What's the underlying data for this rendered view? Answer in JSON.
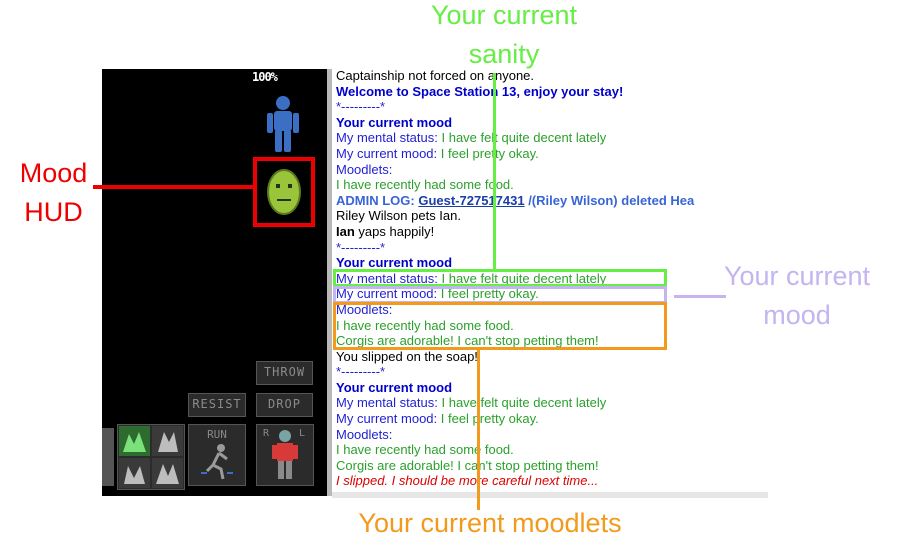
{
  "hud": {
    "health_percent": "100%",
    "buttons": {
      "throw": "THROW",
      "resist": "RESIST",
      "drop": "DROP",
      "run": "RUN",
      "r": "R",
      "l": "L"
    }
  },
  "chat": {
    "lines": [
      {
        "text": "Captainship not forced on anyone."
      },
      {
        "text": "Welcome to Space Station 13, enjoy your stay!"
      },
      {
        "text": "*---------*"
      },
      {
        "text": "Your current mood"
      },
      {
        "label": "My mental status: ",
        "value": "I have felt quite decent lately"
      },
      {
        "label": "My current mood: ",
        "value": "I feel pretty okay."
      },
      {
        "text": "Moodlets:"
      },
      {
        "text": "I have recently had some food."
      },
      {
        "prefix": "ADMIN LOG: ",
        "link": "Guest-727517431",
        "rest": " /(Riley Wilson) deleted Hea"
      },
      {
        "text": "Riley Wilson pets Ian."
      },
      {
        "name": "Ian",
        "rest": " yaps happily!"
      },
      {
        "text": "*---------*"
      },
      {
        "text": "Your current mood"
      },
      {
        "label": "My mental status: ",
        "value": "I have felt quite decent lately"
      },
      {
        "label": "My current mood: ",
        "value": "I feel pretty okay."
      },
      {
        "text": "Moodlets:"
      },
      {
        "text": "I have recently had some food."
      },
      {
        "text": "Corgis are adorable! I can't stop petting them!"
      },
      {
        "text": "You slipped on the soap!"
      },
      {
        "text": "*---------*"
      },
      {
        "text": "Your current mood"
      },
      {
        "label": "My mental status: ",
        "value": "I have felt quite decent lately"
      },
      {
        "label": "My current mood: ",
        "value": "I feel pretty okay."
      },
      {
        "text": "Moodlets:"
      },
      {
        "text": "I have recently had some food."
      },
      {
        "text": "Corgis are adorable! I can't stop petting them!"
      },
      {
        "text": "I slipped. I should be more careful next time..."
      }
    ]
  },
  "annotations": {
    "sanity": "Your current sanity",
    "mood_hud_line1": "Mood",
    "mood_hud_line2": "HUD",
    "mood_line1": "Your current",
    "mood_line2": "mood",
    "moodlets": "Your current moodlets"
  },
  "colors": {
    "sanity": "#66ee44",
    "mood_hud": "#ee0000",
    "mood": "#c4b4f0",
    "moodlets": "#f29a1c"
  }
}
